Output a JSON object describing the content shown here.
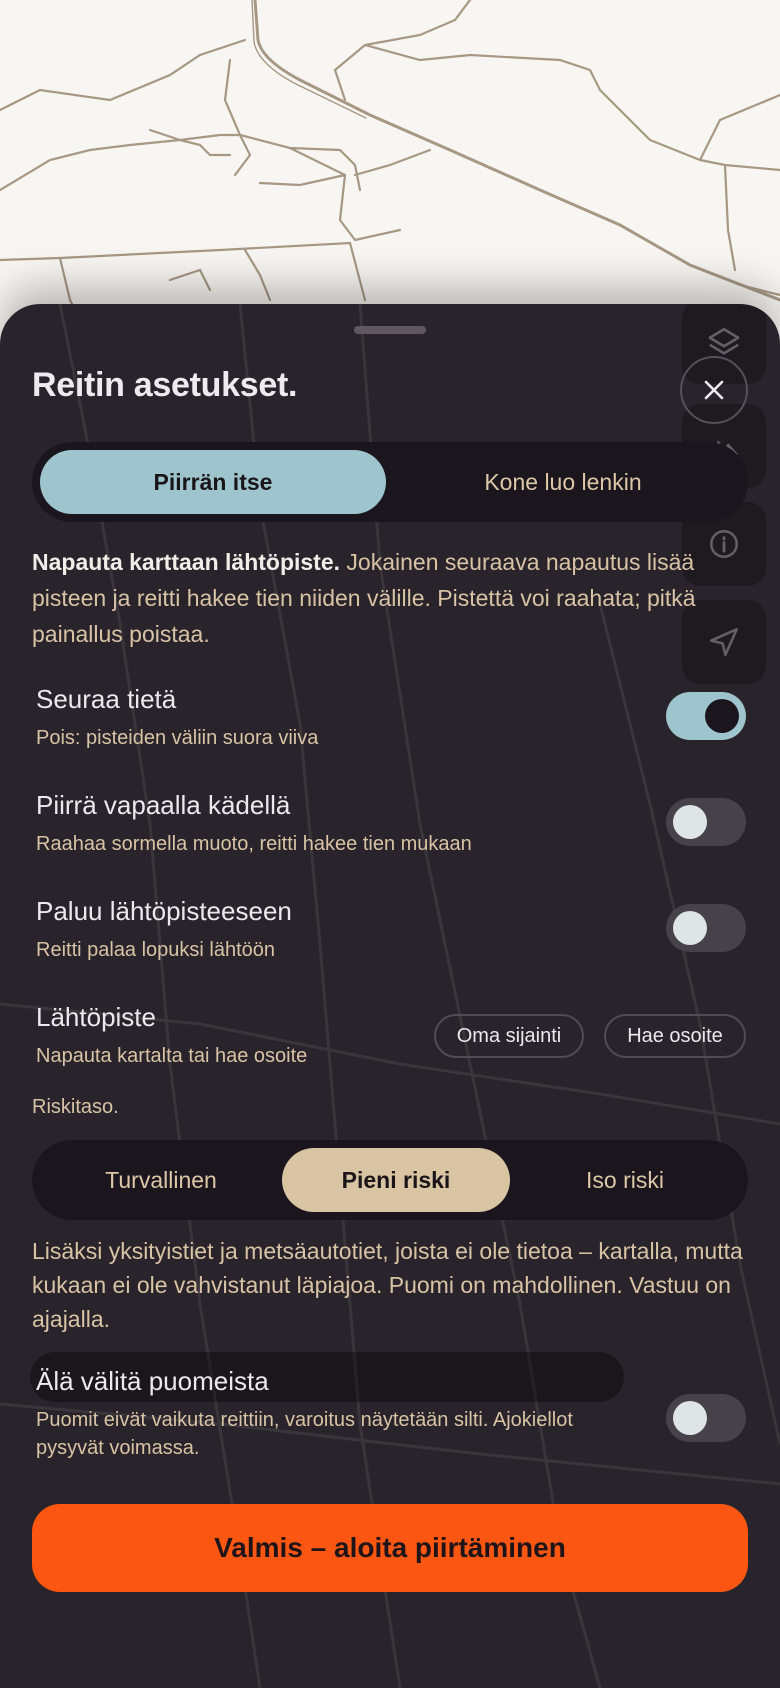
{
  "sheet": {
    "title": "Reitin asetukset.",
    "close_label": "close",
    "mode_tabs": [
      {
        "label": "Piirrän itse",
        "active": true
      },
      {
        "label": "Kone luo lenkin",
        "active": false
      }
    ],
    "info_bold": "Napauta karttaan lähtöpiste.",
    "info_rest": " Jokainen seuraava napautus lisää pisteen ja reitti hakee tien niiden välille. Pistettä voi raahata; pitkä painallus poistaa.",
    "settings": [
      {
        "label": "Seuraa tietä",
        "sub": "Pois: pisteiden väliin suora viiva",
        "on": true
      },
      {
        "label": "Piirrä vapaalla kädellä",
        "sub": "Raahaa sormella muoto, reitti hakee tien mukaan",
        "on": false
      },
      {
        "label": "Paluu lähtöpisteeseen",
        "sub": "Reitti palaa lopuksi lähtöön",
        "on": false
      }
    ],
    "start_point": {
      "label": "Lähtöpiste",
      "sub": "Napauta kartalta tai hae osoite",
      "own_location": "Oma sijainti",
      "search_address": "Hae osoite"
    },
    "risk_label": "Riskitaso.",
    "risk_tabs": [
      {
        "label": "Turvallinen",
        "active": false
      },
      {
        "label": "Pieni riski",
        "active": true
      },
      {
        "label": "Iso riski",
        "active": false
      }
    ],
    "risk_info": "Lisäksi yksityistiet ja metsäautotiet, joista ei ole tietoa – kartalla, mutta kukaan ei ole vahvistanut läpiajoa. Puomi on mahdollinen. Vastuu on ajajalla.",
    "barrier_setting": {
      "label": "Älä välitä puomeista",
      "sub": "Puomit eivät vaikuta reittiin, varoitus näytetään silti. Ajokiellot pysyvät voimassa.",
      "on": false
    },
    "cta_label": "Valmis – aloita piirtäminen"
  },
  "colors": {
    "sheet_bg": "#29242b",
    "accent_teal": "#9ec5cd",
    "accent_beige": "#d9c4a4",
    "cta_orange": "#fb5713",
    "map_bg": "#f8f6f2",
    "road": "#a79884"
  },
  "icons": [
    "layers-icon",
    "terrain-icon",
    "info-icon",
    "navigate-icon",
    "close-icon"
  ]
}
